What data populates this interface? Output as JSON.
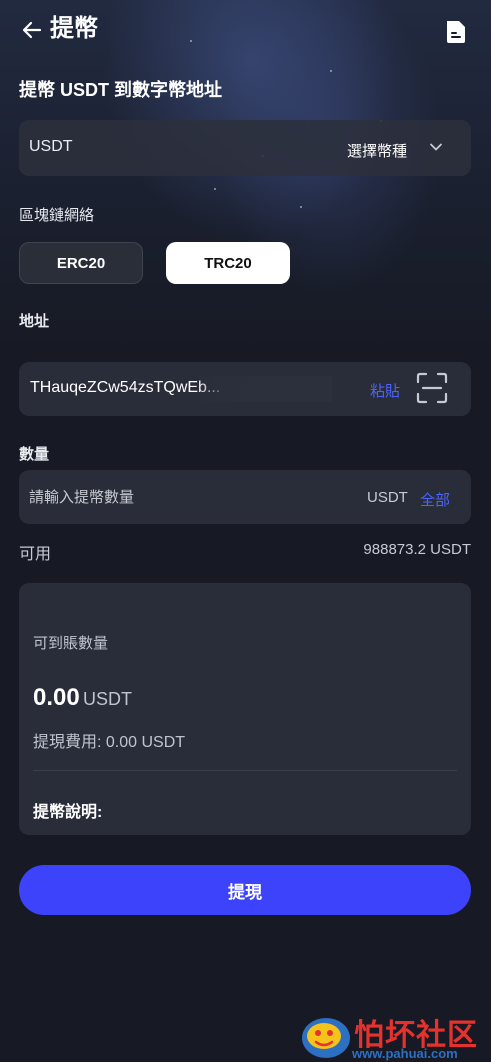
{
  "header": {
    "title": "提幣"
  },
  "section_title": "提幣 USDT 到數字幣地址",
  "coin_select": {
    "value": "USDT",
    "hint": "選擇幣種"
  },
  "network": {
    "label": "區塊鏈網絡",
    "options": [
      "ERC20",
      "TRC20"
    ],
    "selected": "TRC20"
  },
  "address": {
    "label": "地址",
    "value": "THauqeZCw54zsTQwEb...",
    "paste_label": "粘貼"
  },
  "amount": {
    "label": "數量",
    "placeholder": "請輸入提幣數量",
    "unit": "USDT",
    "all_label": "全部"
  },
  "available": {
    "label": "可用",
    "value": "988873.2 USDT"
  },
  "summary": {
    "arrive_label": "可到賬數量",
    "arrive_amount": "0.00",
    "arrive_unit": "USDT",
    "fee_text": "提現費用: 0.00 USDT",
    "note_label": "提幣說明:"
  },
  "submit_label": "提現",
  "watermark": {
    "text": "怕坏社区",
    "url": "www.pahuai.com"
  },
  "colors": {
    "accent": "#3d43fb",
    "link": "#4a63ff",
    "background": "#171a24",
    "card": "#2c303c"
  }
}
